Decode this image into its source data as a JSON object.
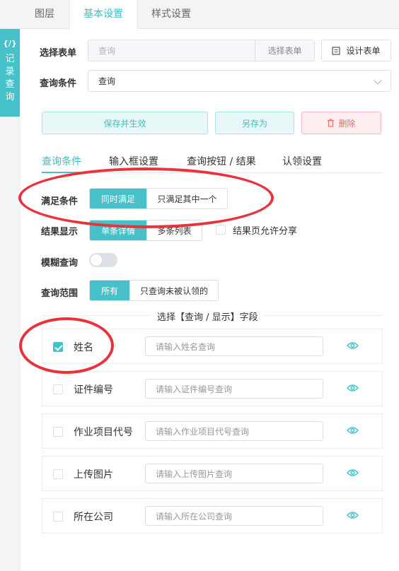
{
  "top_tabs": [
    "图层",
    "基本设置",
    "样式设置"
  ],
  "side_tab": {
    "symbol": "{/}",
    "chars": [
      "记",
      "录",
      "查",
      "询"
    ]
  },
  "form": {
    "select_label": "选择表单",
    "select_placeholder": "查询",
    "select_addon": "选择表单",
    "design_button": "设计表单",
    "condition_label": "查询条件",
    "condition_value": "查询"
  },
  "actions": {
    "save": "保存并生效",
    "save_as": "另存为",
    "delete": "删除"
  },
  "sub_tabs": [
    "查询条件",
    "输入框设置",
    "查询按钮 / 结果",
    "认领设置"
  ],
  "satisfy": {
    "label": "满足条件",
    "options": [
      "同时满足",
      "只满足其中一个"
    ],
    "selected": 0
  },
  "result_display": {
    "label": "结果显示",
    "options": [
      "单条详情",
      "多条列表"
    ],
    "selected": 0,
    "share_label": "结果页允许分享"
  },
  "fuzzy": {
    "label": "模糊查询"
  },
  "scope": {
    "label": "查询范围",
    "options": [
      "所有",
      "只查询未被认领的"
    ],
    "selected": 0
  },
  "fields_title": "选择【查询 / 显示】字段",
  "fields": [
    {
      "name": "姓名",
      "placeholder": "请输入姓名查询",
      "checked": true
    },
    {
      "name": "证件编号",
      "placeholder": "请输入证件编号查询",
      "checked": false
    },
    {
      "name": "作业项目代号",
      "placeholder": "请输入作业项目代号查询",
      "checked": false
    },
    {
      "name": "上传图片",
      "placeholder": "请输入上传图片查询",
      "checked": false
    },
    {
      "name": "所在公司",
      "placeholder": "请输入所在公司查询",
      "checked": false
    }
  ],
  "colors": {
    "accent": "#47c1c9",
    "danger": "#f06a6a",
    "annotation": "#e8333a"
  }
}
